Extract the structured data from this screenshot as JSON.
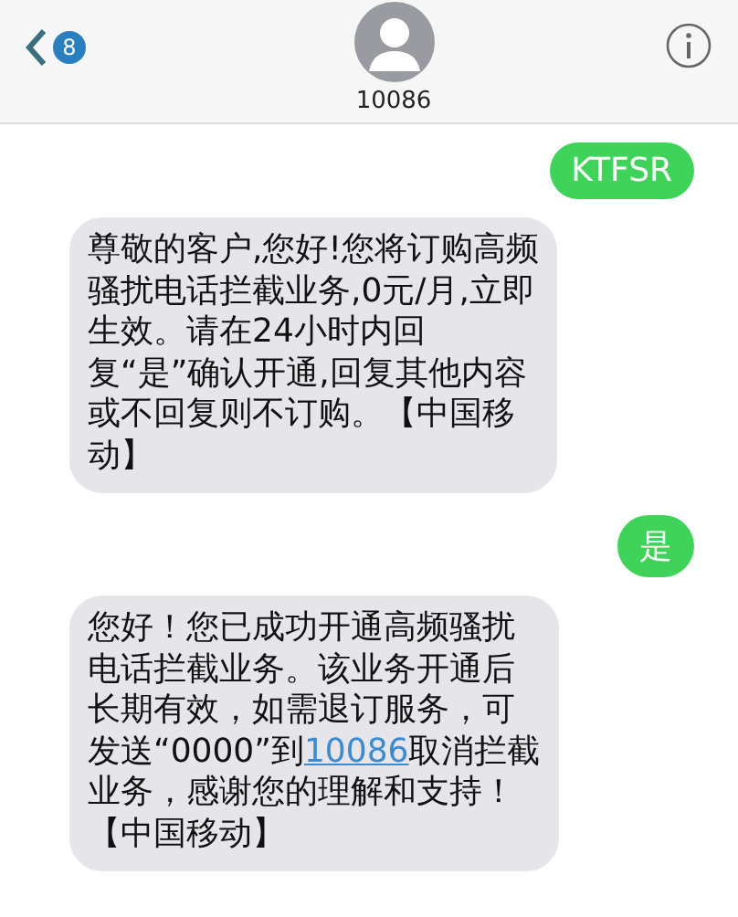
{
  "header": {
    "back_badge": "8",
    "contact": "10086"
  },
  "messages": [
    {
      "kind": "sent",
      "lines": [
        [
          {
            "text": "KTFSR"
          }
        ]
      ]
    },
    {
      "kind": "received",
      "lines": [
        [
          {
            "text": "尊敬的客户,您好!您将订购高频"
          }
        ],
        [
          {
            "text": "骚扰电话拦截业务,0元/月,立即"
          }
        ],
        [
          {
            "text": "生效。请在24小时内回"
          }
        ],
        [
          {
            "text": "复“是”确认开通,回复其他内容"
          }
        ],
        [
          {
            "text": "或不回复则不订购。【中国移"
          }
        ],
        [
          {
            "text": "动】"
          }
        ]
      ]
    },
    {
      "kind": "sent",
      "lines": [
        [
          {
            "text": "是"
          }
        ]
      ]
    },
    {
      "kind": "received",
      "lines": [
        [
          {
            "text": "您好！您已成功开通高频骚扰"
          }
        ],
        [
          {
            "text": "电话拦截业务。该业务开通后"
          }
        ],
        [
          {
            "text": "长期有效，如需退订服务，可"
          }
        ],
        [
          {
            "text": "发送“0000”到"
          },
          {
            "text": "10086",
            "link": true
          },
          {
            "text": "取消拦截"
          }
        ],
        [
          {
            "text": "业务，感谢您的理解和支持！"
          }
        ],
        [
          {
            "text": "【中国移动】"
          }
        ]
      ]
    }
  ]
}
